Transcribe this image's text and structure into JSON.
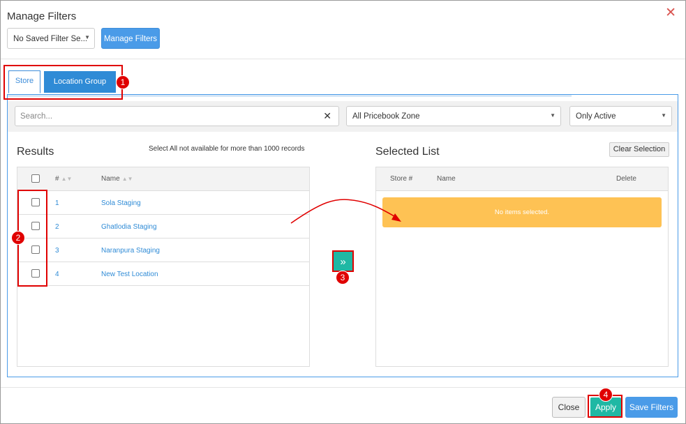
{
  "dialog": {
    "title": "Manage Filters"
  },
  "toolbar": {
    "saved_filter_value": "No Saved Filter Se...",
    "manage_filters_label": "Manage Filters"
  },
  "tabs": [
    {
      "label": "Store"
    },
    {
      "label": "Location Group"
    }
  ],
  "filters": {
    "search_placeholder": "Search...",
    "zone_value": "All Pricebook Zone",
    "status_value": "Only Active"
  },
  "results": {
    "title": "Results",
    "note": "Select All not available for more than 1000 records",
    "columns": {
      "number": "#",
      "name": "Name"
    },
    "rows": [
      {
        "number": "1",
        "name": "Sola Staging"
      },
      {
        "number": "2",
        "name": "Ghatlodia Staging"
      },
      {
        "number": "3",
        "name": "Naranpura Staging"
      },
      {
        "number": "4",
        "name": "New Test Location"
      }
    ]
  },
  "selected": {
    "title": "Selected List",
    "clear_label": "Clear Selection",
    "columns": {
      "store": "Store #",
      "name": "Name",
      "delete": "Delete"
    },
    "empty_message": "No items selected."
  },
  "move_button": {
    "glyph": "»"
  },
  "footer": {
    "close_label": "Close",
    "apply_label": "Apply",
    "save_label": "Save Filters"
  },
  "annotations": [
    {
      "label": "1"
    },
    {
      "label": "2"
    },
    {
      "label": "3"
    },
    {
      "label": "4"
    }
  ],
  "colors": {
    "primary": "#4a9be8",
    "tab_active": "#2f8bd6",
    "teal": "#1fb8a4",
    "warning": "#fec254",
    "annotation_red": "#e00000"
  }
}
